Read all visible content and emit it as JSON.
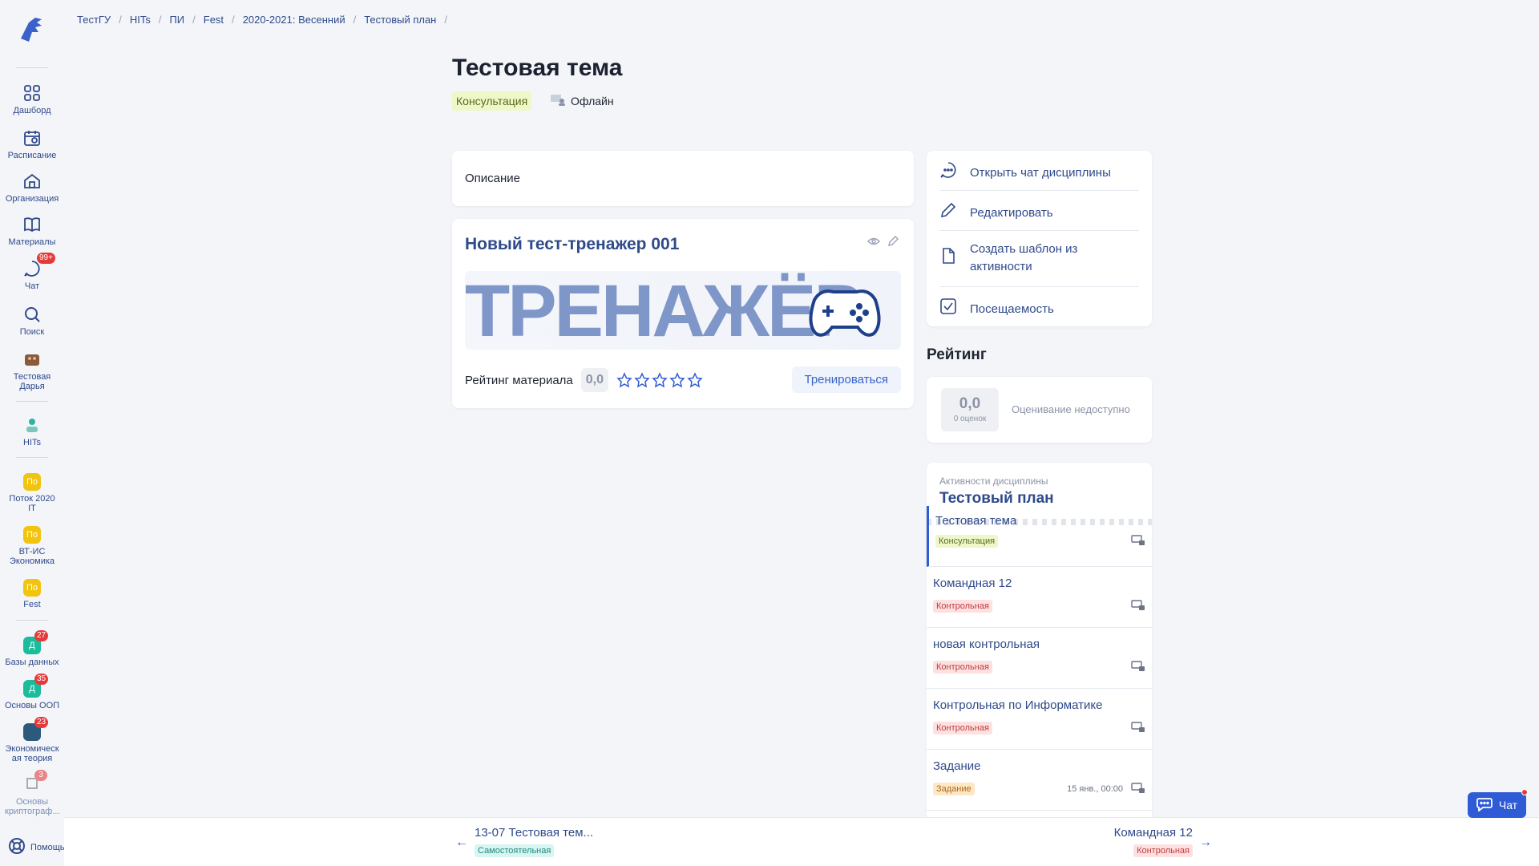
{
  "sidebar": {
    "items": [
      {
        "label": "Дашборд",
        "icon": "dashboard-icon"
      },
      {
        "label": "Расписание",
        "icon": "calendar-icon"
      },
      {
        "label": "Организация",
        "icon": "organization-icon"
      },
      {
        "label": "Материалы",
        "icon": "book-icon"
      },
      {
        "label": "Чат",
        "icon": "chat-icon",
        "badge": "99+"
      },
      {
        "label": "Поиск",
        "icon": "search-icon"
      },
      {
        "label": "Тестовая Дарья",
        "icon": "avatar"
      },
      {
        "label": "HITs",
        "icon": "avatar"
      },
      {
        "label": "Поток 2020 IT",
        "short": "По"
      },
      {
        "label": "ВТ-ИС Экономика",
        "short": "По"
      },
      {
        "label": "Fest",
        "short": "По"
      },
      {
        "label": "Базы данных",
        "short": "Д",
        "badge": "27"
      },
      {
        "label": "Основы ООП",
        "short": "Д",
        "badge": "35"
      },
      {
        "label": "Экономическая теория",
        "badge": "23"
      },
      {
        "label": "Основы криптограф...",
        "badge": "3"
      }
    ],
    "help": "Помощь"
  },
  "breadcrumb": [
    "ТестГУ",
    "HITs",
    "ПИ",
    "Fest",
    "2020-2021: Весенний",
    "Тестовый план"
  ],
  "page": {
    "title": "Тестовая тема",
    "type_tag": "Консультация",
    "format": "Офлайн"
  },
  "description": {
    "label": "Описание"
  },
  "trainer": {
    "title": "Новый тест-тренажер 001",
    "banner_text": "ТРЕНАЖЁР",
    "rating_label": "Рейтинг материала",
    "rating_value": "0,0",
    "train_button": "Тренироваться"
  },
  "actions": [
    {
      "label": "Открыть чат дисциплины",
      "icon": "chat-icon"
    },
    {
      "label": "Редактировать",
      "icon": "pencil-icon"
    },
    {
      "label": "Создать шаблон из активности",
      "icon": "document-icon"
    },
    {
      "label": "Посещаемость",
      "icon": "checkbox-icon"
    }
  ],
  "rating": {
    "title": "Рейтинг",
    "value": "0,0",
    "count": "0 оценок",
    "status": "Оценивание недоступно"
  },
  "plan": {
    "subtitle": "Активности дисциплины",
    "title": "Тестовый план",
    "items": [
      {
        "name": "Тестовая тема",
        "tag": "Консультация",
        "kind": "consult",
        "date": ""
      },
      {
        "name": "Командная 12",
        "tag": "Контрольная",
        "kind": "control",
        "date": ""
      },
      {
        "name": "новая контрольная",
        "tag": "Контрольная",
        "kind": "control",
        "date": ""
      },
      {
        "name": "Контрольная по Информатике",
        "tag": "Контрольная",
        "kind": "control",
        "date": ""
      },
      {
        "name": "Задание",
        "tag": "Задание",
        "kind": "task",
        "date": "15 янв., 00:00"
      }
    ]
  },
  "nav": {
    "prev": {
      "name": "13-07 Тестовая тем...",
      "tag": "Самостоятельная"
    },
    "next": {
      "name": "Командная 12",
      "tag": "Контрольная"
    }
  },
  "chat_button": "Чат",
  "colors": {
    "accent": "#2f5bd6",
    "link": "#2f4a8a",
    "badge": "#e63a3a",
    "background": "#f3f5f9"
  }
}
